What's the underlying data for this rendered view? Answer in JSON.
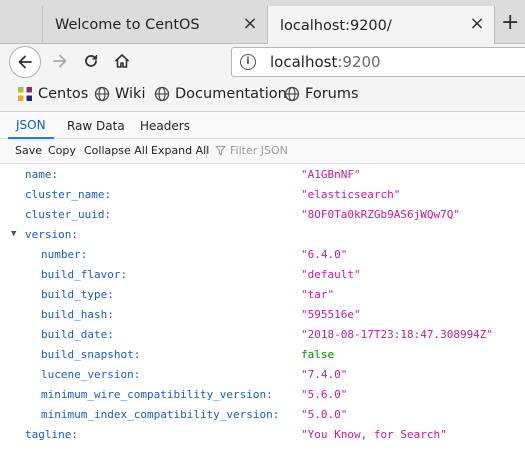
{
  "browser": {
    "tabs": [
      {
        "title": "Welcome to CentOS",
        "close": "×"
      },
      {
        "title": "localhost:9200/",
        "close": "×"
      }
    ],
    "new_tab": "+",
    "url": {
      "host": "localhost",
      "port": ":9200"
    },
    "bookmarks": [
      {
        "label": "Centos",
        "icon": "centos-icon"
      },
      {
        "label": "Wiki",
        "icon": "globe-icon"
      },
      {
        "label": "Documentation",
        "icon": "globe-icon"
      },
      {
        "label": "Forums",
        "icon": "globe-icon"
      }
    ]
  },
  "viewer": {
    "tabs": [
      "JSON",
      "Raw Data",
      "Headers"
    ],
    "actions": [
      "Save",
      "Copy",
      "Collapse All",
      "Expand All"
    ],
    "filter_placeholder": "Filter JSON"
  },
  "json": {
    "rows": [
      {
        "key": "name:",
        "value": "\"A1GBnNF\""
      },
      {
        "key": "cluster_name:",
        "value": "\"elasticsearch\""
      },
      {
        "key": "cluster_uuid:",
        "value": "\"8OF0Ta0kRZGb9AS6jWQw7Q\""
      },
      {
        "key": "version:",
        "value": ""
      },
      {
        "key": "number:",
        "value": "\"6.4.0\""
      },
      {
        "key": "build_flavor:",
        "value": "\"default\""
      },
      {
        "key": "build_type:",
        "value": "\"tar\""
      },
      {
        "key": "build_hash:",
        "value": "\"595516e\""
      },
      {
        "key": "build_date:",
        "value": "\"2018-08-17T23:18:47.308994Z\""
      },
      {
        "key": "build_snapshot:",
        "value": "false"
      },
      {
        "key": "lucene_version:",
        "value": "\"7.4.0\""
      },
      {
        "key": "minimum_wire_compatibility_version:",
        "value": "\"5.6.0\""
      },
      {
        "key": "minimum_index_compatibility_version:",
        "value": "\"5.0.0\""
      },
      {
        "key": "tagline:",
        "value": "\"You Know, for Search\""
      }
    ]
  },
  "colors": {
    "key": "#1a5fb4",
    "string": "#c41aa6",
    "boolean": "#058b00",
    "accent": "#0a84ff"
  }
}
